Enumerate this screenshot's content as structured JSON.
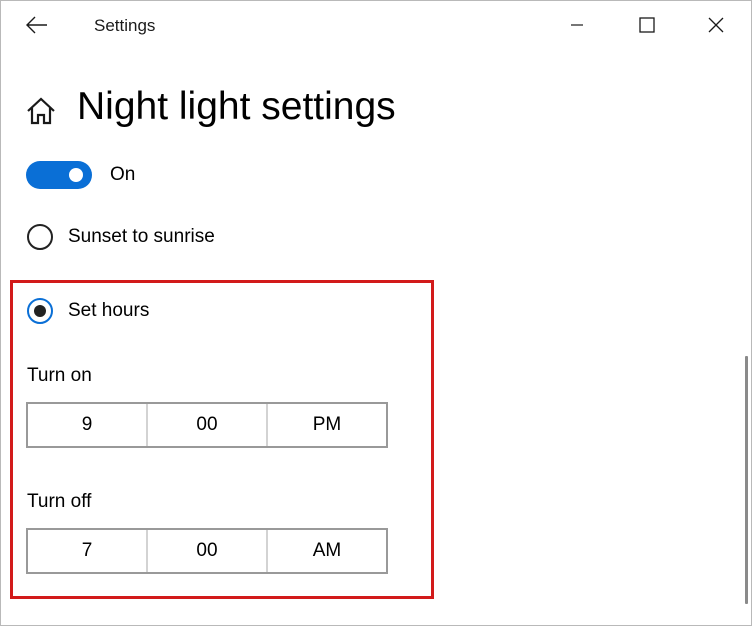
{
  "window": {
    "title": "Settings"
  },
  "page": {
    "title": "Night light settings"
  },
  "night_light": {
    "toggle_state_label": "On",
    "toggle_on": true,
    "toggle_color": "#0a6fd6"
  },
  "schedule": {
    "options": [
      {
        "label": "Sunset to sunrise",
        "selected": false
      },
      {
        "label": "Set hours",
        "selected": true
      }
    ],
    "turn_on": {
      "label": "Turn on",
      "hour": "9",
      "minute": "00",
      "period": "PM"
    },
    "turn_off": {
      "label": "Turn off",
      "hour": "7",
      "minute": "00",
      "period": "AM"
    }
  },
  "highlight_color": "#d21a1a"
}
